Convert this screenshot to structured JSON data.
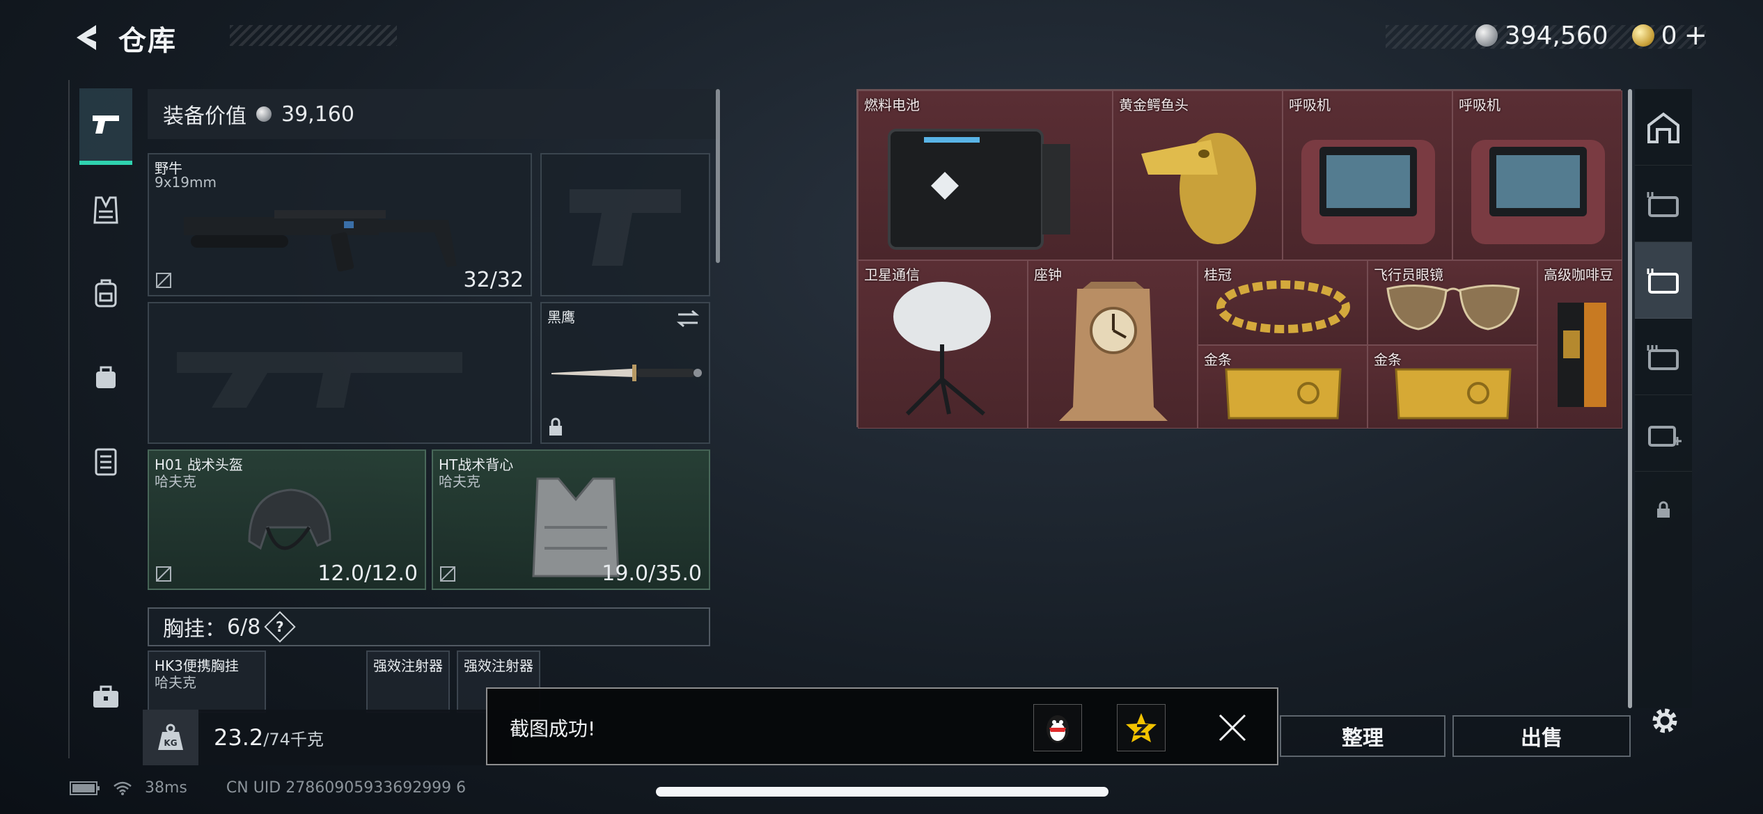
{
  "header": {
    "title": "仓库",
    "silver_amount": "394,560",
    "gold_amount": "0",
    "add_symbol": "+"
  },
  "loadout": {
    "equip_value_label": "装备价值",
    "equip_value": "39,160",
    "primary_weapon": {
      "name": "野牛",
      "caliber": "9x19mm",
      "ammo": "32/32"
    },
    "melee": {
      "name": "黑鹰"
    },
    "helmet": {
      "name": "H01 战术头盔",
      "brand": "哈夫克",
      "durability": "12.0/12.0"
    },
    "vest": {
      "name": "HT战术背心",
      "brand": "哈夫克",
      "durability": "19.0/35.0"
    },
    "chest_rig": {
      "label": "胸挂：",
      "capacity": "6/8",
      "help": "?",
      "item_name": "HK3便携胸挂",
      "item_brand": "哈夫克",
      "slots": [
        "强效注射器",
        "强效注射器"
      ]
    },
    "weight": {
      "current": "23.2",
      "limit": "/74千克",
      "icon_label": "KG"
    }
  },
  "stash": {
    "items": [
      {
        "name": "燃料电池"
      },
      {
        "name": "黄金鳄鱼头"
      },
      {
        "name": "呼吸机"
      },
      {
        "name": "呼吸机"
      },
      {
        "name": "卫星通信"
      },
      {
        "name": "座钟"
      },
      {
        "name": "桂冠"
      },
      {
        "name": "飞行员眼镜"
      },
      {
        "name": "高级咖啡豆"
      },
      {
        "name": "金条"
      },
      {
        "name": "金条"
      }
    ]
  },
  "actions": {
    "organize": "整理",
    "sell": "出售"
  },
  "toast": {
    "message": "截图成功!"
  },
  "status": {
    "ping": "38ms",
    "uid": "CN UID 27860905933692999 6"
  },
  "colors": {
    "accent": "#2fd3b0",
    "stash_bg": "#4a262b",
    "equip_green": "#28403a"
  }
}
